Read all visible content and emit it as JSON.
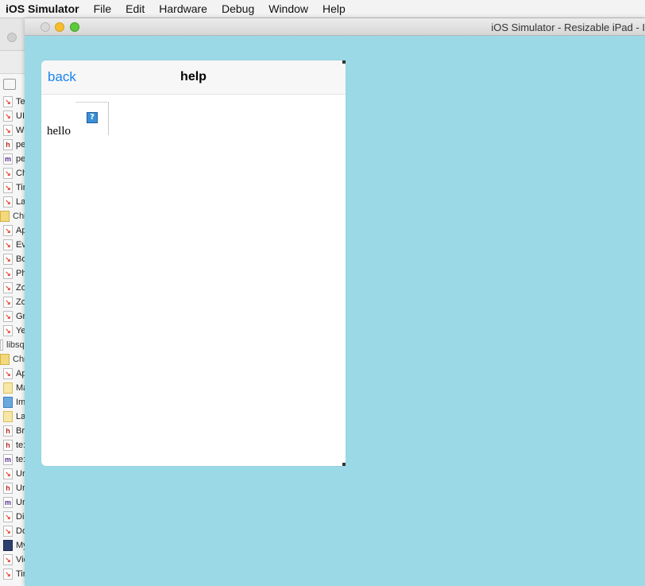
{
  "menubar": {
    "app_name": "iOS Simulator",
    "items": [
      "File",
      "Edit",
      "Hardware",
      "Debug",
      "Window",
      "Help"
    ]
  },
  "background_window": {
    "file_items": [
      {
        "label": "Te",
        "kind": "swift"
      },
      {
        "label": "UI",
        "kind": "swift"
      },
      {
        "label": "W",
        "kind": "swift"
      },
      {
        "label": "pe",
        "kind": "h"
      },
      {
        "label": "pe",
        "kind": "m"
      },
      {
        "label": "Ch",
        "kind": "swift"
      },
      {
        "label": "Tir",
        "kind": "swift"
      },
      {
        "label": "La",
        "kind": "swift"
      },
      {
        "label": "Chro",
        "kind": "folder"
      },
      {
        "label": "Ap",
        "kind": "swift"
      },
      {
        "label": "Ev",
        "kind": "swift"
      },
      {
        "label": "Bo",
        "kind": "swift"
      },
      {
        "label": "Ph",
        "kind": "swift"
      },
      {
        "label": "Zo",
        "kind": "swift"
      },
      {
        "label": "Zo",
        "kind": "swift"
      },
      {
        "label": "Gr",
        "kind": "swift"
      },
      {
        "label": "Ye",
        "kind": "swift"
      },
      {
        "label": "libsq",
        "kind": "plain"
      },
      {
        "label": "Chro",
        "kind": "folder"
      },
      {
        "label": "Ap",
        "kind": "swift"
      },
      {
        "label": "Ma",
        "kind": "asset"
      },
      {
        "label": "Im",
        "kind": "blue"
      },
      {
        "label": "La",
        "kind": "asset"
      },
      {
        "label": "Br",
        "kind": "h"
      },
      {
        "label": "te:",
        "kind": "h"
      },
      {
        "label": "te:",
        "kind": "m"
      },
      {
        "label": "Ur",
        "kind": "swift"
      },
      {
        "label": "Ur",
        "kind": "h"
      },
      {
        "label": "Ur",
        "kind": "m"
      },
      {
        "label": "Dia",
        "kind": "swift"
      },
      {
        "label": "Do",
        "kind": "swift"
      },
      {
        "label": "My",
        "kind": "dark"
      },
      {
        "label": "Vie",
        "kind": "swift"
      },
      {
        "label": "Tir",
        "kind": "swift"
      }
    ]
  },
  "simulator": {
    "window_title": "iOS Simulator - Resizable iPad - I",
    "panel": {
      "back_label": "back",
      "title": "help",
      "body_text": "hello",
      "broken_image_glyph": "?"
    }
  },
  "colors": {
    "simulator_background": "#9cd9e7",
    "link_blue": "#1a82f0"
  }
}
